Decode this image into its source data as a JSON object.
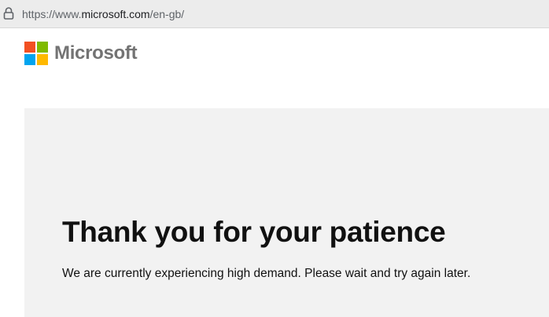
{
  "browser": {
    "url_prefix": "https://www.",
    "url_host": "microsoft.com",
    "url_path": "/en-gb/",
    "lock_icon": "lock-icon"
  },
  "header": {
    "brand": "Microsoft",
    "logo_colors": {
      "red": "#f25022",
      "green": "#7fba00",
      "blue": "#00a4ef",
      "yellow": "#ffb900"
    }
  },
  "main": {
    "heading": "Thank you for your patience",
    "message": "We are currently experiencing high demand. Please wait and try again later."
  }
}
